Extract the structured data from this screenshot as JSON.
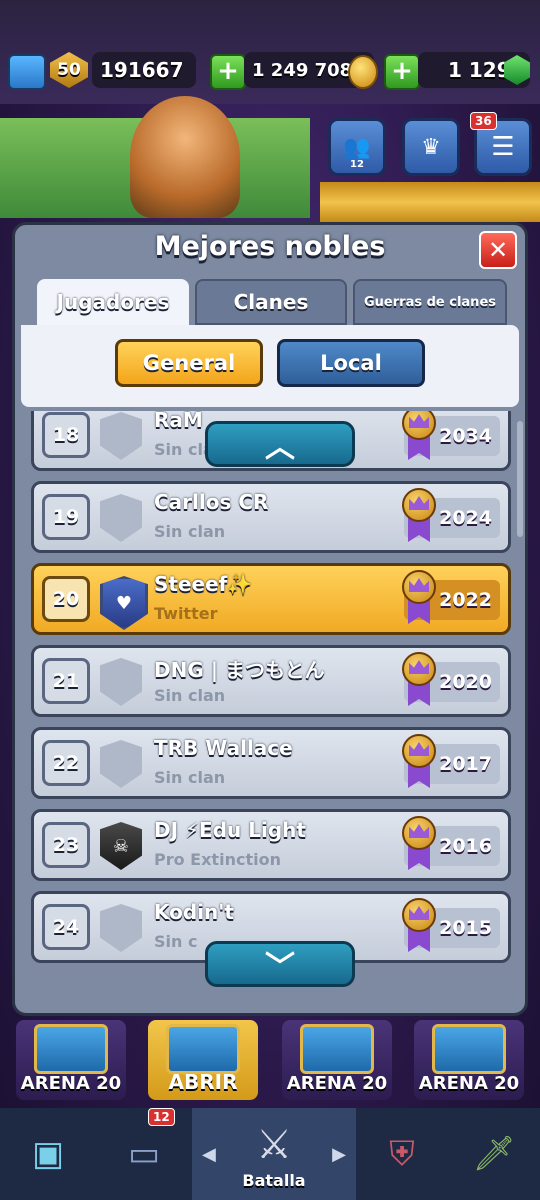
{
  "top_bar": {
    "level": "50",
    "trophies": "191667",
    "gold": "1 249 708",
    "gems": "1 129",
    "notifications": "36",
    "friends_count": "12"
  },
  "modal": {
    "title": "Mejores nobles",
    "close_label": "✕",
    "tabs": [
      {
        "label": "Jugadores",
        "active": true
      },
      {
        "label": "Clanes",
        "active": false
      },
      {
        "label": "Guerras de clanes",
        "active": false
      }
    ],
    "filters": {
      "general": "General",
      "local": "Local"
    },
    "scroll_up": "︿",
    "scroll_down": "﹀"
  },
  "rows": [
    {
      "rank": "18",
      "name": "RaM",
      "clan": "Sin clan",
      "score": "2034",
      "me": false,
      "shield": "none"
    },
    {
      "rank": "19",
      "name": "Carllos CR",
      "clan": "Sin clan",
      "score": "2024",
      "me": false,
      "shield": "none"
    },
    {
      "rank": "20",
      "name": "Steeef✨",
      "clan": "Twitter",
      "score": "2022",
      "me": true,
      "shield": "twitter"
    },
    {
      "rank": "21",
      "name": "DNG | まつもとん",
      "clan": "Sin clan",
      "score": "2020",
      "me": false,
      "shield": "none"
    },
    {
      "rank": "22",
      "name": "TRB Wallace",
      "clan": "Sin clan",
      "score": "2017",
      "me": false,
      "shield": "none"
    },
    {
      "rank": "23",
      "name": "DJ ⚡Edu Light",
      "clan": "Pro Extinction",
      "score": "2016",
      "me": false,
      "shield": "pro"
    },
    {
      "rank": "24",
      "name": "Kodin't",
      "clan": "Sin c",
      "score": "2015",
      "me": false,
      "shield": "none"
    }
  ],
  "chests": [
    {
      "label": "ARENA 20"
    },
    {
      "label": "ABRIR"
    },
    {
      "label": "ARENA 20"
    },
    {
      "label": "ARENA 20"
    }
  ],
  "nav": {
    "cards_badge": "12",
    "center_label": "Batalla"
  },
  "colors": {
    "accent_gold": "#f3a41a",
    "accent_blue": "#2f5f9a",
    "close_red": "#c8201a"
  }
}
